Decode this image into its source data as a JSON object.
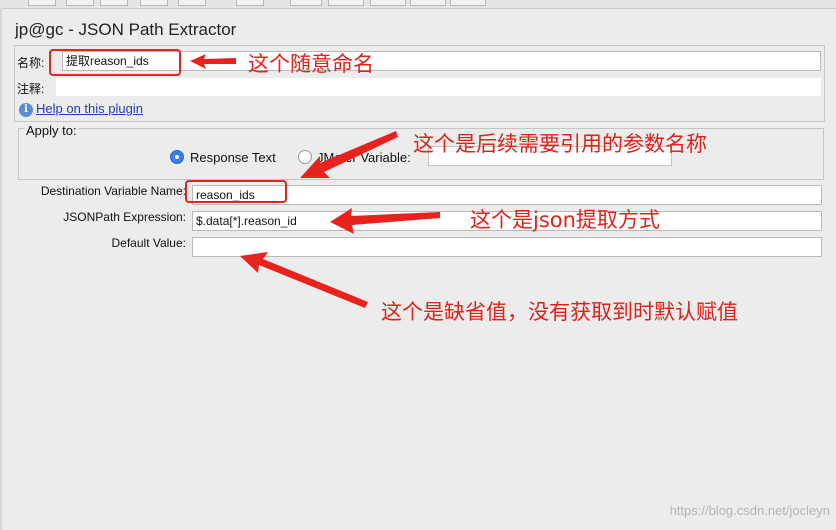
{
  "panel_title": "jp@gc - JSON Path Extractor",
  "name_label": "名称:",
  "name_value": "提取reason_ids",
  "comment_label": "注释:",
  "help_link": "Help on this plugin",
  "apply_to": {
    "legend": "Apply to:",
    "response_text": "Response Text",
    "jmeter_variable": "JMeter Variable:",
    "selected": "Response Text"
  },
  "fields": {
    "dest_var_label": "Destination Variable Name:",
    "dest_var_value": "reason_ids",
    "jsonpath_label": "JSONPath Expression:",
    "jsonpath_value": "$.data[*].reason_id",
    "default_label": "Default Value:",
    "default_value": ""
  },
  "annotations": {
    "name_note": "这个随意命名",
    "var_note": "这个是后续需要引用的参数名称",
    "jsonpath_note": "这个是json提取方式",
    "default_note": "这个是缺省值，没有获取到时默认赋值"
  },
  "watermark": "https://blog.csdn.net/jocleyn",
  "colors": {
    "annotation_red": "#e32119",
    "link_blue": "#1f3fbf",
    "radio_selected": "#3a7ff0"
  }
}
